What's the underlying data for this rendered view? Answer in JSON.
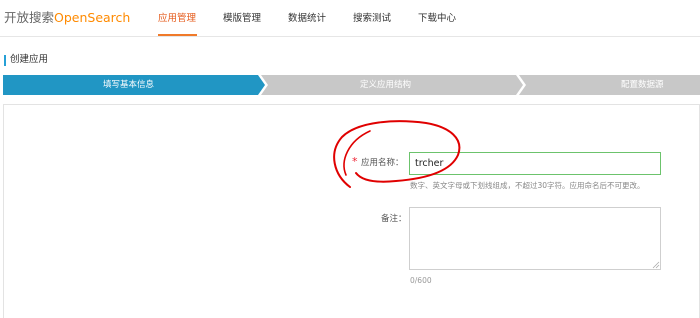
{
  "brand": {
    "name_cn": "开放搜索",
    "name_en": "OpenSearch"
  },
  "nav": {
    "items": [
      {
        "label": "应用管理",
        "active": true
      },
      {
        "label": "模版管理",
        "active": false
      },
      {
        "label": "数据统计",
        "active": false
      },
      {
        "label": "搜索测试",
        "active": false
      },
      {
        "label": "下载中心",
        "active": false
      }
    ]
  },
  "page": {
    "title": "创建应用"
  },
  "steps": [
    {
      "label": "填写基本信息",
      "state": "active"
    },
    {
      "label": "定义应用结构",
      "state": "inactive"
    },
    {
      "label": "配置数据源",
      "state": "inactive"
    }
  ],
  "form": {
    "name": {
      "label": "应用名称：",
      "required_mark": "*",
      "value": "trcher",
      "hint": "数字、英文字母或下划线组成，不超过30字符。应用命名后不可更改。"
    },
    "remark": {
      "label": "备注：",
      "value": "",
      "counter": "0/600"
    }
  },
  "colors": {
    "accent": "#e55a1a",
    "step_active": "#2196c4",
    "step_inactive": "#c8c8c8",
    "input_border_valid": "#6cc36c",
    "annotation": "#e00000"
  }
}
